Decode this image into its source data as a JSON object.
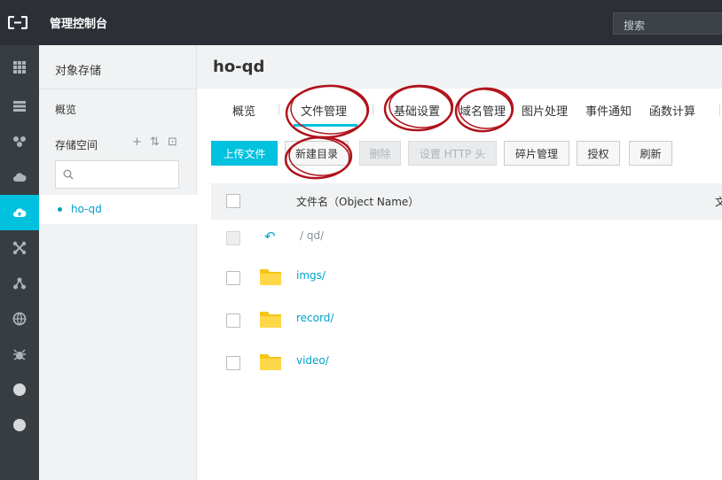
{
  "header": {
    "app_title": "管理控制台",
    "search_label": "搜索"
  },
  "rail": {
    "items": [
      {
        "icon": "grid-icon"
      },
      {
        "icon": "server-icon"
      },
      {
        "icon": "network-icon"
      },
      {
        "icon": "cloud-icon"
      },
      {
        "icon": "cloud-upload-icon",
        "active": true
      },
      {
        "icon": "cluster-icon"
      },
      {
        "icon": "nodes-icon"
      },
      {
        "icon": "globe-icon"
      },
      {
        "icon": "bug-icon"
      },
      {
        "icon": "circle-icon"
      },
      {
        "icon": "circle-icon"
      }
    ]
  },
  "sidebar": {
    "title": "对象存储",
    "overview": "概览",
    "space_label": "存储空间",
    "tools": [
      "+",
      "⇅",
      "⊡"
    ],
    "bucket_name": "ho-qd"
  },
  "main": {
    "bucket_title": "ho-qd",
    "tabs": [
      {
        "label": "概览"
      },
      {
        "label": "文件管理",
        "active": true
      },
      {
        "label": "基础设置"
      },
      {
        "label": "域名管理"
      },
      {
        "label": "图片处理"
      },
      {
        "label": "事件通知"
      },
      {
        "label": "函数计算"
      }
    ],
    "toolbar": {
      "upload": "上传文件",
      "new_dir": "新建目录",
      "delete": "删除",
      "http_header": "设置 HTTP 头",
      "fragments": "碎片管理",
      "authorize": "授权",
      "refresh": "刷新"
    },
    "table": {
      "col_name": "文件名（Object Name）",
      "col_next": "文",
      "path": "/  qd/",
      "rows": [
        {
          "name": "imgs/"
        },
        {
          "name": "record/"
        },
        {
          "name": "video/"
        }
      ]
    }
  },
  "colors": {
    "accent": "#00c1de",
    "link": "#00a2ca",
    "topbar": "#2c3036",
    "rail": "#373d41",
    "folder": "#f5c518",
    "annotation": "#b0121b"
  }
}
